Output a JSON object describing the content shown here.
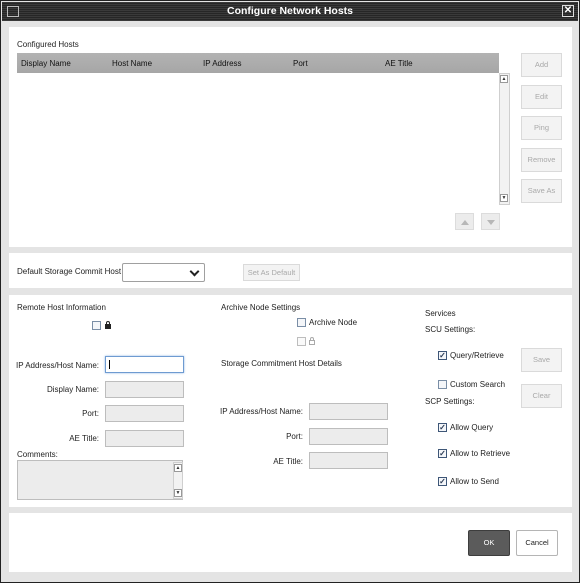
{
  "window": {
    "title": "Configure Network Hosts"
  },
  "hosts": {
    "section_label": "Configured Hosts",
    "columns": [
      "Display Name",
      "Host Name",
      "IP Address",
      "Port",
      "AE Title"
    ],
    "rows": [],
    "buttons": {
      "add": "Add",
      "edit": "Edit",
      "ping": "Ping",
      "remove": "Remove",
      "save_as": "Save As"
    }
  },
  "storage_commit": {
    "label": "Default Storage Commit Host",
    "selected": "",
    "set_default_label": "Set As Default"
  },
  "remote_host": {
    "section_label": "Remote Host Information",
    "locked": false,
    "ip_label": "IP Address/Host Name:",
    "ip_value": "",
    "display_label": "Display Name:",
    "display_value": "",
    "port_label": "Port:",
    "port_value": "",
    "ae_label": "AE Title:",
    "ae_value": "",
    "comments_label": "Comments:",
    "comments_value": ""
  },
  "archive": {
    "section_label": "Archive Node Settings",
    "archive_node_label": "Archive Node",
    "archive_node_checked": false,
    "commitment_label": "Storage Commitment Host Details",
    "ip_label": "IP Address/Host Name:",
    "ip_value": "",
    "port_label": "Port:",
    "port_value": "",
    "ae_label": "AE Title:",
    "ae_value": ""
  },
  "services": {
    "section_label": "Services",
    "scu_label": "SCU Settings:",
    "query_retrieve_label": "Query/Retrieve",
    "query_retrieve_checked": true,
    "custom_search_label": "Custom Search",
    "custom_search_checked": false,
    "scp_label": "SCP Settings:",
    "allow_query_label": "Allow Query",
    "allow_query_checked": true,
    "allow_retrieve_label": "Allow to Retrieve",
    "allow_retrieve_checked": true,
    "allow_send_label": "Allow to Send",
    "allow_send_checked": true,
    "save_label": "Save",
    "clear_label": "Clear"
  },
  "footer": {
    "ok_label": "OK",
    "cancel_label": "Cancel"
  },
  "colors": {
    "titlebar": "#2b2b2b",
    "panel": "#ffffff",
    "frame": "#e4e4e4",
    "ok_button": "#5b5b5b"
  }
}
